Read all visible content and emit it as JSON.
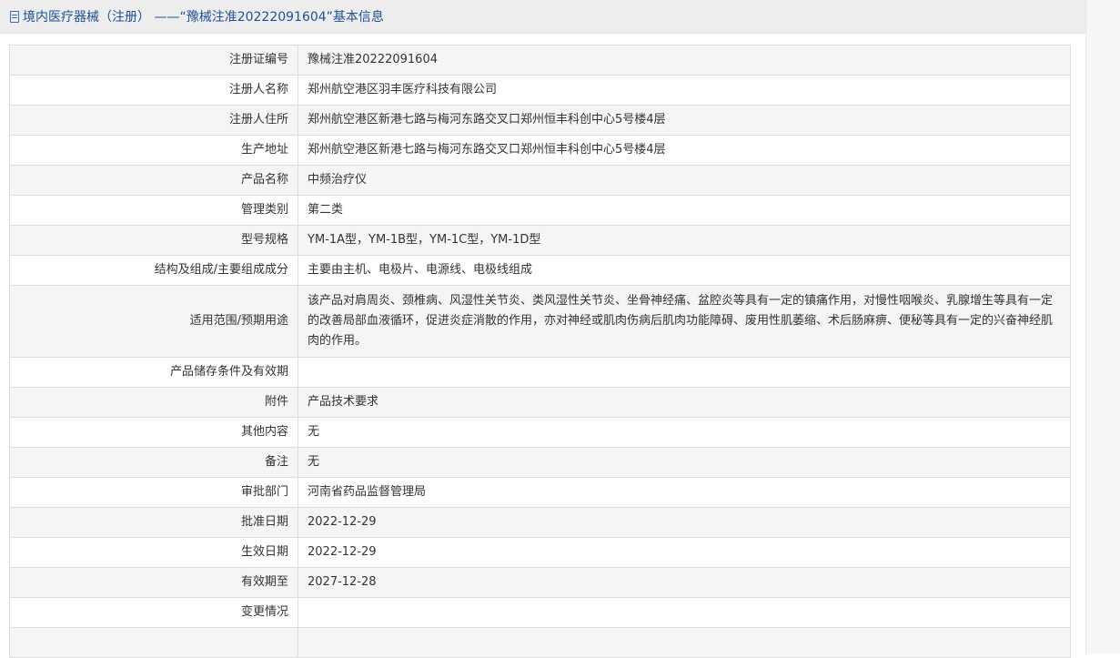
{
  "header": {
    "title": "境内医疗器械（注册） ——“豫械注准20222091604”基本信息"
  },
  "rows": [
    {
      "label": "注册证编号",
      "value": "豫械注准20222091604"
    },
    {
      "label": "注册人名称",
      "value": "郑州航空港区羽丰医疗科技有限公司"
    },
    {
      "label": "注册人住所",
      "value": "郑州航空港区新港七路与梅河东路交叉口郑州恒丰科创中心5号楼4层"
    },
    {
      "label": "生产地址",
      "value": "郑州航空港区新港七路与梅河东路交叉口郑州恒丰科创中心5号楼4层"
    },
    {
      "label": "产品名称",
      "value": "中频治疗仪"
    },
    {
      "label": "管理类别",
      "value": "第二类"
    },
    {
      "label": "型号规格",
      "value": "YM-1A型，YM-1B型，YM-1C型，YM-1D型"
    },
    {
      "label": "结构及组成/主要组成成分",
      "value": "主要由主机、电极片、电源线、电极线组成"
    },
    {
      "label": "适用范围/预期用途",
      "value": "该产品对肩周炎、颈椎病、风湿性关节炎、类风湿性关节炎、坐骨神经痛、盆腔炎等具有一定的镇痛作用，对慢性咽喉炎、乳腺增生等具有一定的改善局部血液循环，促进炎症消散的作用，亦对神经或肌肉伤病后肌肉功能障碍、废用性肌萎缩、术后肠麻痹、便秘等具有一定的兴奋神经肌肉的作用。"
    },
    {
      "label": "产品储存条件及有效期",
      "value": ""
    },
    {
      "label": "附件",
      "value": "产品技术要求"
    },
    {
      "label": "其他内容",
      "value": "无"
    },
    {
      "label": "备注",
      "value": "无"
    },
    {
      "label": "审批部门",
      "value": "河南省药品监督管理局"
    },
    {
      "label": "批准日期",
      "value": "2022-12-29"
    },
    {
      "label": "生效日期",
      "value": "2022-12-29"
    },
    {
      "label": "有效期至",
      "value": "2027-12-28"
    },
    {
      "label": "变更情况",
      "value": ""
    },
    {
      "label": "",
      "value": ""
    }
  ]
}
